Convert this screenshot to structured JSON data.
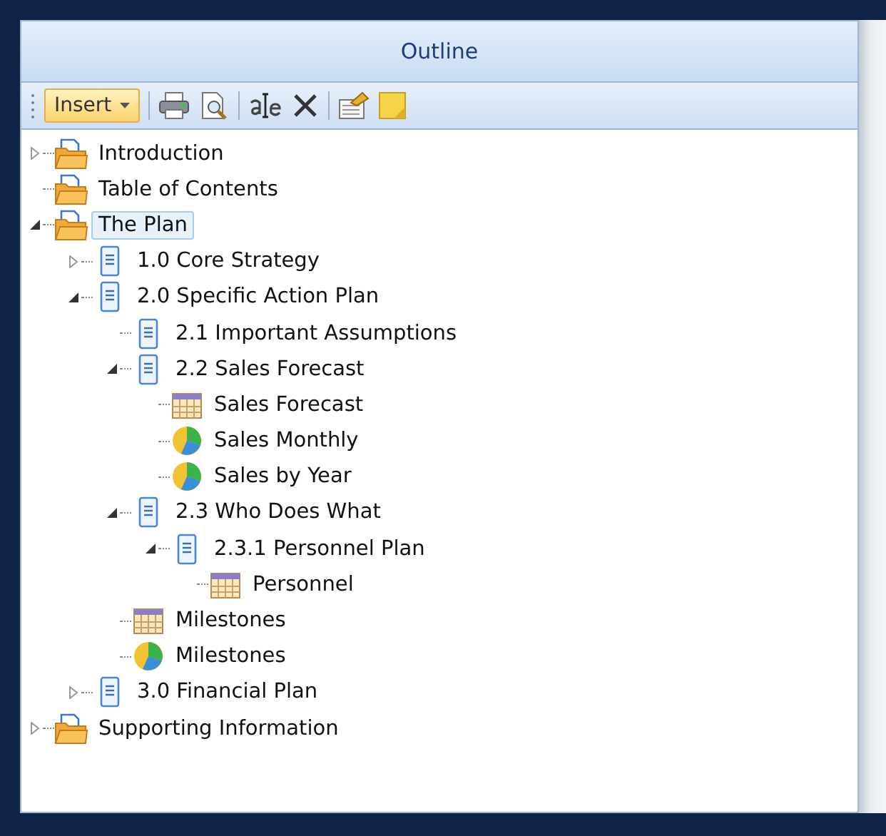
{
  "panel": {
    "title": "Outline"
  },
  "toolbar": {
    "insert_label": "Insert"
  },
  "tree": [
    {
      "label": "Introduction",
      "kind": "folder",
      "expanded": false,
      "selected": false
    },
    {
      "label": "Table of Contents",
      "kind": "folder",
      "selected": false
    },
    {
      "label": "The Plan",
      "kind": "folder",
      "expanded": true,
      "selected": true,
      "children": [
        {
          "label": "1.0 Core Strategy",
          "kind": "doc",
          "expanded": false,
          "selected": false
        },
        {
          "label": "2.0 Specific Action Plan",
          "kind": "doc",
          "expanded": true,
          "selected": false,
          "children": [
            {
              "label": "2.1 Important Assumptions",
              "kind": "doc",
              "selected": false
            },
            {
              "label": "2.2 Sales Forecast",
              "kind": "doc",
              "expanded": true,
              "selected": false,
              "children": [
                {
                  "label": "Sales Forecast",
                  "kind": "table",
                  "selected": false
                },
                {
                  "label": "Sales Monthly",
                  "kind": "chart",
                  "selected": false
                },
                {
                  "label": "Sales by Year",
                  "kind": "chart",
                  "selected": false
                }
              ]
            },
            {
              "label": "2.3 Who Does What",
              "kind": "doc",
              "expanded": true,
              "selected": false,
              "children": [
                {
                  "label": "2.3.1 Personnel Plan",
                  "kind": "doc",
                  "expanded": true,
                  "selected": false,
                  "children": [
                    {
                      "label": "Personnel",
                      "kind": "table",
                      "selected": false
                    }
                  ]
                }
              ]
            },
            {
              "label": "Milestones",
              "kind": "table",
              "selected": false
            },
            {
              "label": "Milestones",
              "kind": "chart",
              "selected": false
            }
          ]
        },
        {
          "label": "3.0 Financial Plan",
          "kind": "doc",
          "expanded": false,
          "selected": false
        }
      ]
    },
    {
      "label": "Supporting Information",
      "kind": "folder",
      "expanded": false,
      "selected": false
    }
  ]
}
